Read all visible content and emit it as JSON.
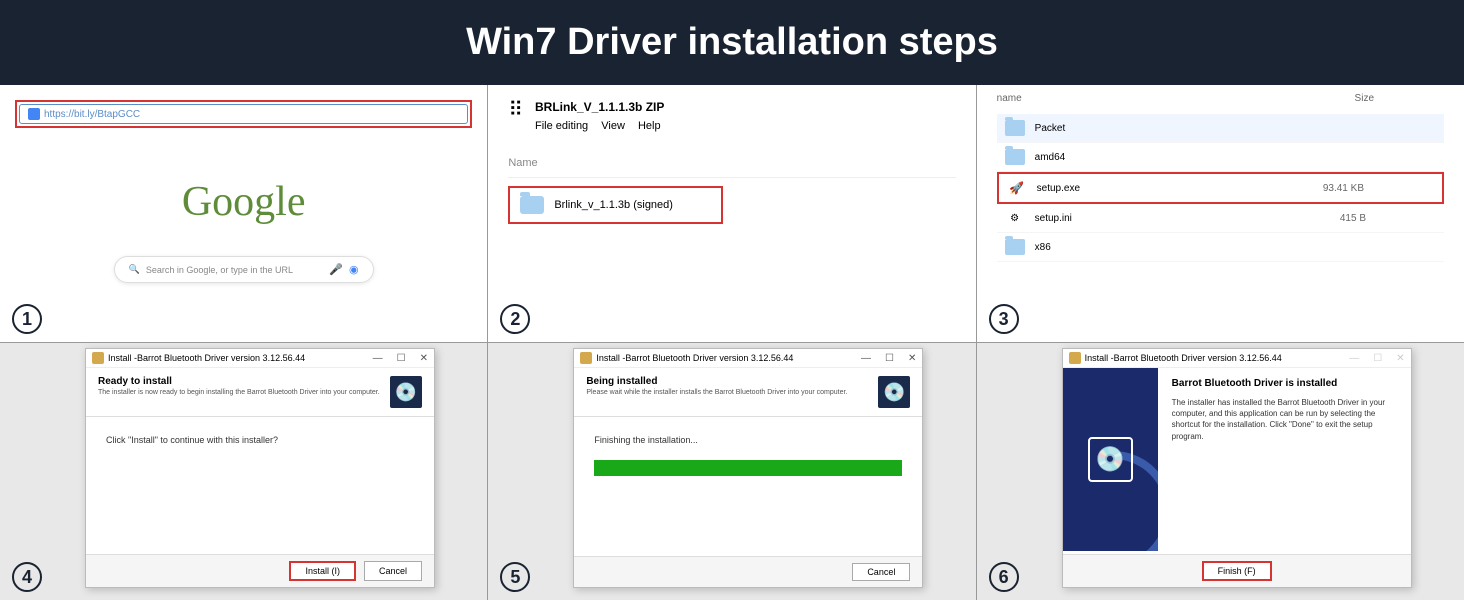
{
  "title": "Win7 Driver installation steps",
  "step1": {
    "url": "https://bit.ly/BtapGCC",
    "logo": "Google",
    "search_placeholder": "Search in Google, or type in the URL"
  },
  "step2": {
    "zip_title": "BRLink_V_1.1.1.3b ZIP",
    "menu_file": "File editing",
    "menu_view": "View",
    "menu_help": "Help",
    "name_label": "Name",
    "folder_name": "Brlink_v_1.1.3b (signed)"
  },
  "step3": {
    "col_name": "name",
    "col_size": "Size",
    "files": [
      {
        "name": "Packet",
        "type": "folder",
        "size": ""
      },
      {
        "name": "amd64",
        "type": "folder",
        "size": ""
      },
      {
        "name": "setup.exe",
        "type": "exe",
        "size": "93.41 KB"
      },
      {
        "name": "setup.ini",
        "type": "ini",
        "size": "415 B"
      },
      {
        "name": "x86",
        "type": "folder",
        "size": ""
      }
    ]
  },
  "installer": {
    "window_title": "Install -Barrot Bluetooth Driver version 3.12.56.44"
  },
  "step4": {
    "heading": "Ready to install",
    "sub": "The installer is now ready to begin installing the Barrot Bluetooth Driver into your computer.",
    "body": "Click \"Install\" to continue with this installer?",
    "btn_install": "Install (I)",
    "btn_cancel": "Cancel"
  },
  "step5": {
    "heading": "Being installed",
    "sub": "Please wait while the installer installs the Barrot Bluetooth Driver into your computer.",
    "body": "Finishing the installation...",
    "btn_cancel": "Cancel"
  },
  "step6": {
    "heading": "Barrot Bluetooth Driver is installed",
    "body": "The installer has installed the Barrot Bluetooth Driver in your computer, and this application can be run by selecting the shortcut for the installation. Click \"Done\" to exit the setup program.",
    "btn_finish": "Finish (F)"
  },
  "nums": {
    "n1": "1",
    "n2": "2",
    "n3": "3",
    "n4": "4",
    "n5": "5",
    "n6": "6"
  }
}
